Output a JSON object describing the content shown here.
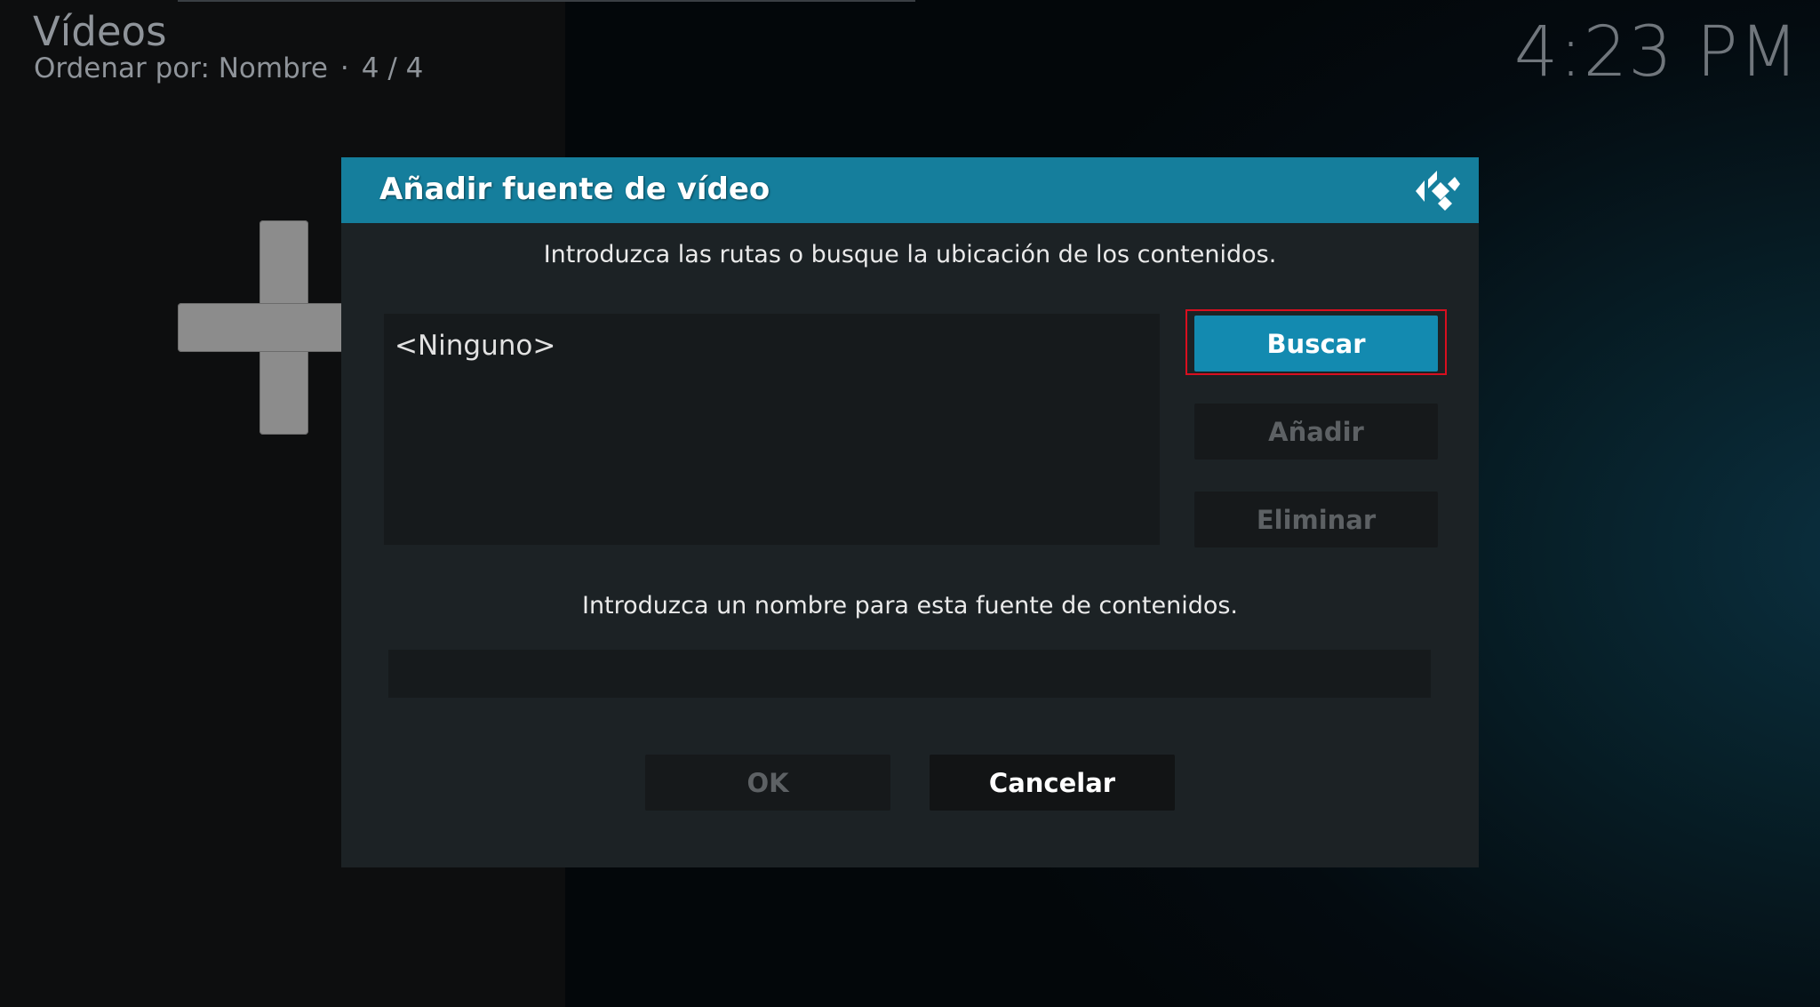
{
  "header": {
    "title": "Vídeos",
    "sort_label": "Ordenar por: Nombre",
    "separator": "·",
    "count": "4 / 4"
  },
  "clock": "4:23 PM",
  "dialog": {
    "title": "Añadir fuente de vídeo",
    "path_prompt": "Introduzca las rutas o busque la ubicación de los contenidos.",
    "paths": [
      "<Ninguno>"
    ],
    "buttons": {
      "browse": "Buscar",
      "add": "Añadir",
      "remove": "Eliminar"
    },
    "name_prompt": "Introduzca un nombre para esta fuente de contenidos.",
    "name_value": "",
    "ok": "OK",
    "cancel": "Cancelar"
  },
  "colors": {
    "dialog_header": "#157e9c",
    "focused_button": "#138ab0",
    "focus_outline": "#d90f1f",
    "dialog_body": "#1c2225"
  },
  "icons": {
    "background_tile": "plus-icon",
    "brand": "kodi-logo-icon"
  }
}
